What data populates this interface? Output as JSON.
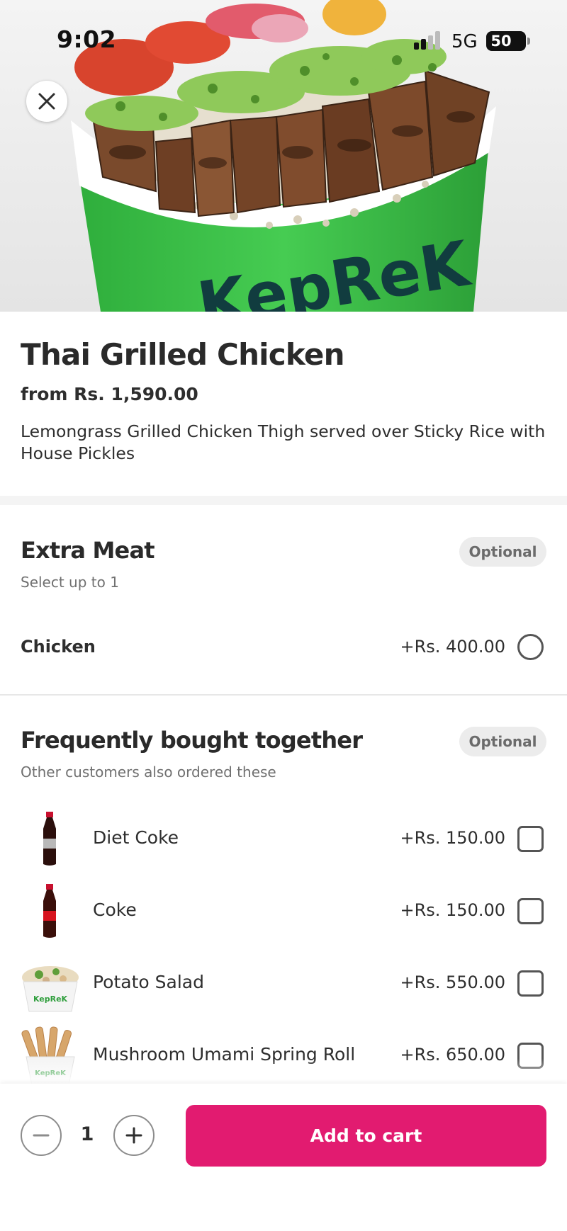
{
  "status_bar": {
    "time": "9:02",
    "network": "5G",
    "battery": "50"
  },
  "hero": {
    "brand_text": "KepReK"
  },
  "product": {
    "title": "Thai Grilled Chicken",
    "price": "from Rs. 1,590.00",
    "description": "Lemongrass Grilled Chicken Thigh served over Sticky Rice with House Pickles"
  },
  "extra_meat": {
    "title": "Extra Meat",
    "badge": "Optional",
    "subtitle": "Select up to 1",
    "options": [
      {
        "name": "Chicken",
        "price": "+Rs. 400.00"
      }
    ]
  },
  "frequently_bought": {
    "title": "Frequently bought together",
    "badge": "Optional",
    "subtitle": "Other customers also ordered these",
    "items": [
      {
        "name": "Diet Coke",
        "price": "+Rs. 150.00",
        "icon": "soda-bottle-icon"
      },
      {
        "name": "Coke",
        "price": "+Rs. 150.00",
        "icon": "soda-bottle-icon"
      },
      {
        "name": "Potato Salad",
        "price": "+Rs. 550.00",
        "icon": "salad-bowl-icon"
      },
      {
        "name": "Mushroom Umami Spring Roll",
        "price": "+Rs. 650.00",
        "icon": "spring-roll-cup-icon"
      }
    ]
  },
  "footer": {
    "quantity": "1",
    "add_label": "Add to cart"
  },
  "colors": {
    "accent": "#e21b70",
    "bowl_green": "#3ec24a"
  }
}
